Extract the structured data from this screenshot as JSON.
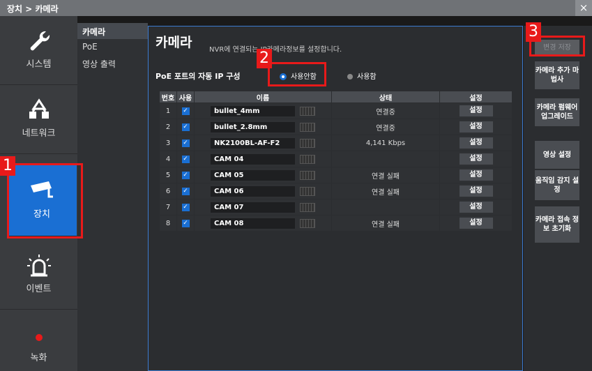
{
  "titlebar": {
    "breadcrumb": "장치 > 카메라",
    "close": "×"
  },
  "leftnav": [
    {
      "label": "시스템",
      "icon": "wrench-icon"
    },
    {
      "label": "네트워크",
      "icon": "network-icon"
    },
    {
      "label": "장치",
      "icon": "camera-icon"
    },
    {
      "label": "이벤트",
      "icon": "alarm-icon"
    },
    {
      "label": "녹화",
      "icon": "record-dot-icon"
    }
  ],
  "subnav": [
    "카메라",
    "PoE",
    "영상 출력"
  ],
  "main": {
    "title": "카메라",
    "description": "NVR에 연결되는 IP카메라정보를 설정합니다.",
    "poe_label": "PoE 포트의 자동 IP 구성",
    "radio_off": "사용안함",
    "radio_on": "사용함",
    "columns": [
      "번호",
      "사용",
      "이름",
      "상태",
      "설정"
    ],
    "rows": [
      {
        "num": "1",
        "name": "bullet_4mm",
        "status": "연결중",
        "btn": "설정"
      },
      {
        "num": "2",
        "name": "bullet_2.8mm",
        "status": "연결중",
        "btn": "설정"
      },
      {
        "num": "3",
        "name": "NK2100BL-AF-F2",
        "status": "4,141 Kbps",
        "btn": "설정"
      },
      {
        "num": "4",
        "name": "CAM 04",
        "status": "",
        "btn": "설정"
      },
      {
        "num": "5",
        "name": "CAM 05",
        "status": "연결 실패",
        "btn": "설정"
      },
      {
        "num": "6",
        "name": "CAM 06",
        "status": "연결 실패",
        "btn": "설정"
      },
      {
        "num": "7",
        "name": "CAM 07",
        "status": "",
        "btn": "설정"
      },
      {
        "num": "8",
        "name": "CAM 08",
        "status": "연결 실패",
        "btn": "설정"
      }
    ]
  },
  "right": {
    "save": "변경 저장",
    "wizard": "카메라 추가 마법사",
    "firmware": "카메라 펌웨어 업그레이드",
    "video": "영상 설정",
    "motion": "움직임 감지 설정",
    "reset": "카메라 접속 정보 초기화"
  },
  "annotations": [
    "1",
    "2",
    "3"
  ],
  "colors": {
    "accent": "#1a6fd3",
    "highlight": "#e81a1a"
  }
}
